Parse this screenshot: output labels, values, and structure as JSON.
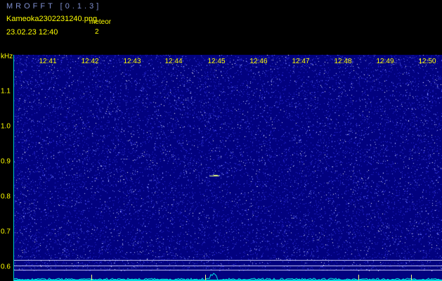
{
  "header": {
    "app_title": "MROFFT [0.1.3]",
    "file_name": "Kameoka2302231240.png",
    "timestamp": "23.02.23  12:40",
    "meteor_label": "meteor",
    "meteor_count": "2"
  },
  "axis": {
    "freq_unit": "kHz",
    "time_labels": [
      "12:41",
      "12:42",
      "12:43",
      "12:44",
      "12:45",
      "12:46",
      "12:47",
      "12:48",
      "12:49",
      "12:50"
    ],
    "freq_labels": [
      "1.1",
      "1.0",
      "0.9",
      "0.8",
      "0.7",
      "0.6"
    ]
  },
  "colors": {
    "background": "#000000",
    "spectrogram_bg": "#02027f",
    "label": "#ffff00",
    "title": "#7f8fcf",
    "baseline": "#00e0e0"
  }
}
